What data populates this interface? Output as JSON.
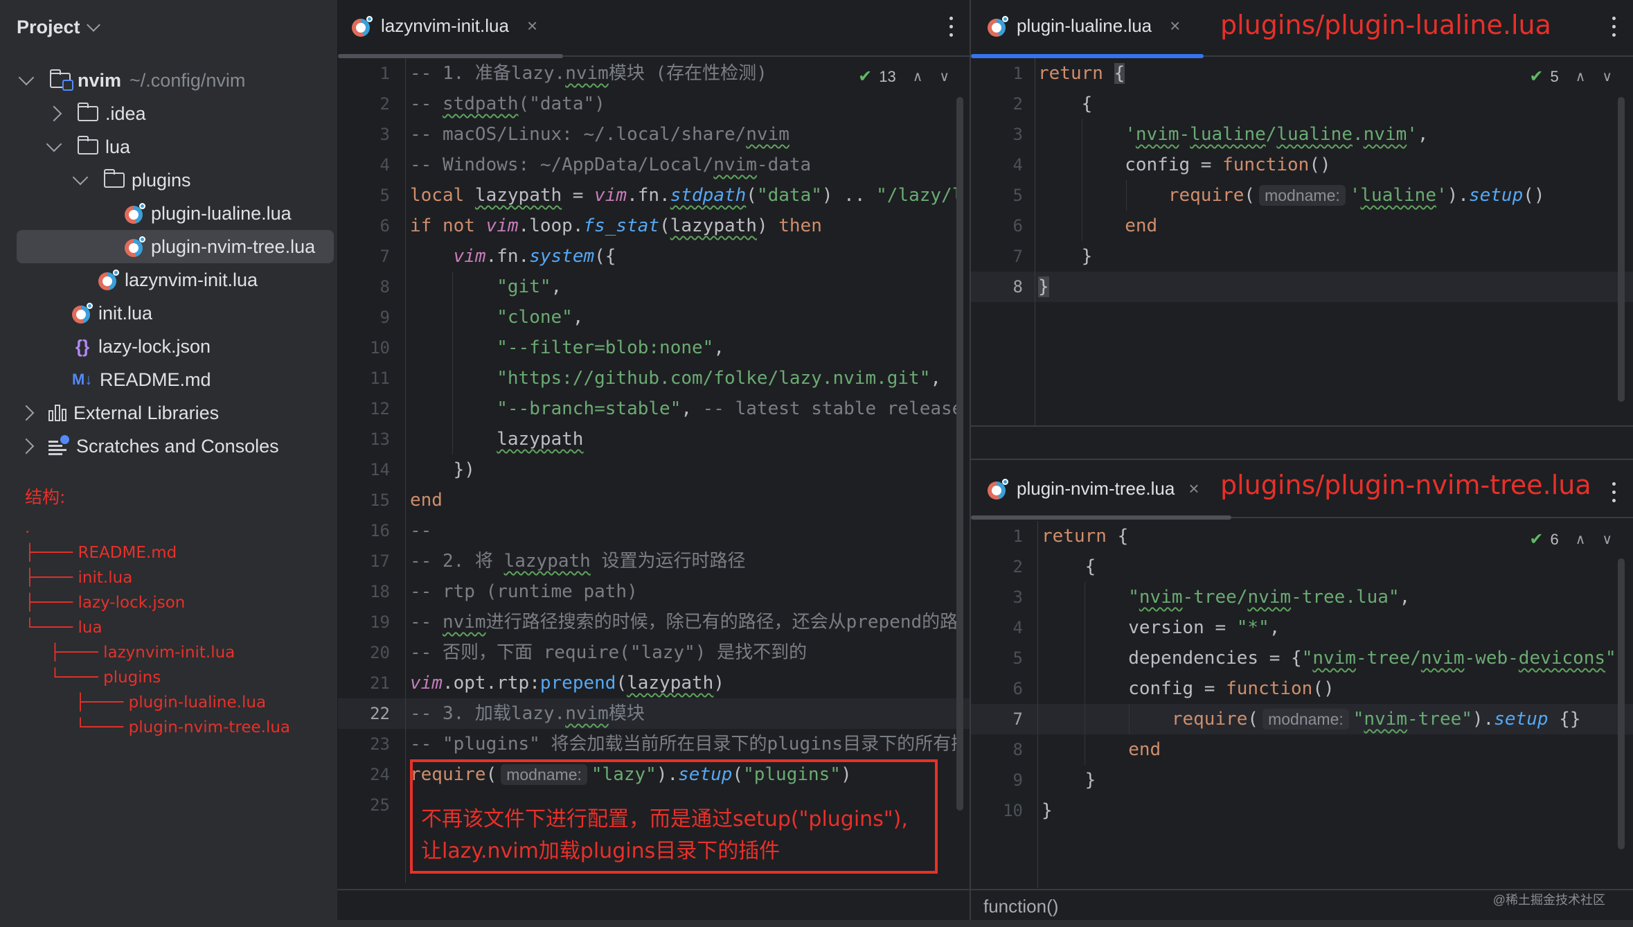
{
  "sidebar": {
    "title": "Project",
    "tree": [
      {
        "label": "nvim",
        "sub": "~/.config/nvim",
        "icon": "module-folder-icon",
        "expanded": true
      },
      {
        "label": ".idea",
        "icon": "folder-icon",
        "expanded": false
      },
      {
        "label": "lua",
        "icon": "folder-icon",
        "expanded": true
      },
      {
        "label": "plugins",
        "icon": "folder-icon",
        "expanded": true
      },
      {
        "label": "plugin-lualine.lua",
        "icon": "lua-file-icon"
      },
      {
        "label": "plugin-nvim-tree.lua",
        "icon": "lua-file-icon",
        "selected": true
      },
      {
        "label": "lazynvim-init.lua",
        "icon": "lua-file-icon"
      },
      {
        "label": "init.lua",
        "icon": "lua-file-icon"
      },
      {
        "label": "lazy-lock.json",
        "icon": "json-file-icon",
        "glyph": "{}"
      },
      {
        "label": "README.md",
        "icon": "markdown-file-icon",
        "glyph": "M↓"
      },
      {
        "label": "External Libraries",
        "icon": "libraries-icon",
        "expanded": false
      },
      {
        "label": "Scratches and Consoles",
        "icon": "scratches-icon",
        "expanded": false
      }
    ]
  },
  "annotation": {
    "structure_title": "结构:",
    "structure_lines": [
      ".",
      "├──── README.md",
      "├──── init.lua",
      "├──── lazy-lock.json",
      "└──── lua",
      "     ├──── lazynvim-init.lua",
      "     └──── plugins",
      "          ├──── plugin-lualine.lua",
      "          └──── plugin-nvim-tree.lua"
    ],
    "middle_note_line1": "不再该文件下进行配置，而是通过setup(\"plugins\"),",
    "middle_note_line2": "让lazy.nvim加载plugins目录下的插件",
    "top_right_path": "plugins/plugin-lualine.lua",
    "bottom_right_path": "plugins/plugin-nvim-tree.lua",
    "color": "#e8302a"
  },
  "editors": {
    "main": {
      "tab": "lazynvim-init.lua",
      "inspections": "13",
      "current_line": 22,
      "lines": [
        "1",
        "2",
        "3",
        "4",
        "5",
        "6",
        "7",
        "8",
        "9",
        "10",
        "11",
        "12",
        "13",
        "14",
        "15",
        "16",
        "17",
        "18",
        "19",
        "20",
        "21",
        "22",
        "23",
        "24",
        "25"
      ]
    },
    "top_right": {
      "tab": "plugin-lualine.lua",
      "inspections": "5",
      "current_line": 8,
      "lines": [
        "1",
        "2",
        "3",
        "4",
        "5",
        "6",
        "7",
        "8"
      ]
    },
    "bottom_right": {
      "tab": "plugin-nvim-tree.lua",
      "inspections": "6",
      "current_line": 7,
      "lines": [
        "1",
        "2",
        "3",
        "4",
        "5",
        "6",
        "7",
        "8",
        "9",
        "10"
      ],
      "breadcrumb": "function()"
    }
  },
  "code": {
    "main": [
      [
        {
          "t": "-- 1. 准备lazy.",
          "c": "c"
        },
        {
          "t": "nvim",
          "c": "c w"
        },
        {
          "t": "模块 (存在性检测)",
          "c": "c"
        }
      ],
      [
        {
          "t": "-- ",
          "c": "c"
        },
        {
          "t": "stdpath",
          "c": "c w"
        },
        {
          "t": "(\"data\")",
          "c": "c"
        }
      ],
      [
        {
          "t": "-- macOS/Linux: ~/.local/share/",
          "c": "c"
        },
        {
          "t": "nvim",
          "c": "c w"
        }
      ],
      [
        {
          "t": "-- Windows: ~/AppData/Local/",
          "c": "c"
        },
        {
          "t": "nvim",
          "c": "c w"
        },
        {
          "t": "-data",
          "c": "c"
        }
      ],
      [
        {
          "t": "local ",
          "c": "k"
        },
        {
          "t": "lazypath",
          "c": "w"
        },
        {
          "t": " = "
        },
        {
          "t": "vim",
          "c": "g"
        },
        {
          "t": ".fn."
        },
        {
          "t": "stdpath",
          "c": "f w"
        },
        {
          "t": "("
        },
        {
          "t": "\"data\"",
          "c": "s"
        },
        {
          "t": ") .. "
        },
        {
          "t": "\"/lazy/lazy.nvim\"",
          "c": "s"
        }
      ],
      [
        {
          "t": "if not ",
          "c": "k"
        },
        {
          "t": "vim",
          "c": "g"
        },
        {
          "t": ".loop."
        },
        {
          "t": "fs_stat",
          "c": "f"
        },
        {
          "t": "("
        },
        {
          "t": "lazypath",
          "c": "w"
        },
        {
          "t": ") "
        },
        {
          "t": "then",
          "c": "k"
        }
      ],
      [
        {
          "t": "    "
        },
        {
          "t": "vim",
          "c": "g"
        },
        {
          "t": ".fn."
        },
        {
          "t": "system",
          "c": "f"
        },
        {
          "t": "({"
        }
      ],
      [
        {
          "t": "        "
        },
        {
          "t": "\"git\"",
          "c": "s"
        },
        {
          "t": ","
        }
      ],
      [
        {
          "t": "        "
        },
        {
          "t": "\"clone\"",
          "c": "s"
        },
        {
          "t": ","
        }
      ],
      [
        {
          "t": "        "
        },
        {
          "t": "\"--filter=blob:none\"",
          "c": "s"
        },
        {
          "t": ","
        }
      ],
      [
        {
          "t": "        "
        },
        {
          "t": "\"https://github.com/folke/lazy.nvim.git\"",
          "c": "s"
        },
        {
          "t": ","
        }
      ],
      [
        {
          "t": "        "
        },
        {
          "t": "\"--branch=stable\"",
          "c": "s"
        },
        {
          "t": ", "
        },
        {
          "t": "-- latest stable release",
          "c": "c"
        }
      ],
      [
        {
          "t": "        "
        },
        {
          "t": "lazypath",
          "c": "w"
        }
      ],
      [
        {
          "t": "    })"
        }
      ],
      [
        {
          "t": "end",
          "c": "k"
        }
      ],
      [
        {
          "t": "--",
          "c": "c"
        }
      ],
      [
        {
          "t": "-- 2. 将 ",
          "c": "c"
        },
        {
          "t": "lazypath",
          "c": "c w"
        },
        {
          "t": " 设置为运行时路径",
          "c": "c"
        }
      ],
      [
        {
          "t": "-- rtp (runtime path)",
          "c": "c"
        }
      ],
      [
        {
          "t": "-- ",
          "c": "c"
        },
        {
          "t": "nvim",
          "c": "c w"
        },
        {
          "t": "进行路径搜索的时候，除已有的路径，还会从prepend的路径中查找",
          "c": "c"
        }
      ],
      [
        {
          "t": "-- 否则，下面 require(\"lazy\") 是找不到的",
          "c": "c"
        }
      ],
      [
        {
          "t": "vim",
          "c": "g"
        },
        {
          "t": ".opt.rtp:"
        },
        {
          "t": "prepend",
          "c": "fn"
        },
        {
          "t": "("
        },
        {
          "t": "lazypath",
          "c": "w"
        },
        {
          "t": ")"
        }
      ],
      [
        {
          "t": "-- 3. 加载lazy.",
          "c": "c"
        },
        {
          "t": "nvim",
          "c": "c w"
        },
        {
          "t": "模块",
          "c": "c"
        }
      ],
      [
        {
          "t": "-- \"plugins\" 将会加载当前所在目录下的plugins目录下的所有插件",
          "c": "c"
        }
      ],
      [
        {
          "t": "require",
          "c": "k"
        },
        {
          "t": "("
        },
        {
          "t": "modname:",
          "c": "hint"
        },
        {
          "t": "\"lazy\"",
          "c": "s"
        },
        {
          "t": ")."
        },
        {
          "t": "setup",
          "c": "f"
        },
        {
          "t": "("
        },
        {
          "t": "\"plugins\"",
          "c": "s"
        },
        {
          "t": ")"
        }
      ],
      []
    ],
    "top_right": [
      [
        {
          "t": "return ",
          "c": "k"
        },
        {
          "t": "{",
          "c": "brace-hl"
        }
      ],
      [
        {
          "t": "    {"
        }
      ],
      [
        {
          "t": "        "
        },
        {
          "t": "'",
          "c": "s"
        },
        {
          "t": "nvim",
          "c": "s w"
        },
        {
          "t": "-",
          "c": "s"
        },
        {
          "t": "lualine",
          "c": "s w"
        },
        {
          "t": "/",
          "c": "s"
        },
        {
          "t": "lualine",
          "c": "s w"
        },
        {
          "t": ".",
          "c": "s"
        },
        {
          "t": "nvim",
          "c": "s w"
        },
        {
          "t": "'",
          "c": "s"
        },
        {
          "t": ","
        }
      ],
      [
        {
          "t": "        config = "
        },
        {
          "t": "function",
          "c": "k"
        },
        {
          "t": "()"
        }
      ],
      [
        {
          "t": "            "
        },
        {
          "t": "require",
          "c": "k"
        },
        {
          "t": "("
        },
        {
          "t": "modname:",
          "c": "hint"
        },
        {
          "t": "'",
          "c": "s"
        },
        {
          "t": "lualine",
          "c": "s w"
        },
        {
          "t": "'",
          "c": "s"
        },
        {
          "t": ")."
        },
        {
          "t": "setup",
          "c": "f"
        },
        {
          "t": "()"
        }
      ],
      [
        {
          "t": "        "
        },
        {
          "t": "end",
          "c": "k"
        }
      ],
      [
        {
          "t": "    }"
        }
      ],
      [
        {
          "t": "}",
          "c": "brace-hl"
        }
      ]
    ],
    "bottom_right": [
      [
        {
          "t": "return ",
          "c": "k"
        },
        {
          "t": "{"
        }
      ],
      [
        {
          "t": "    {"
        }
      ],
      [
        {
          "t": "        "
        },
        {
          "t": "\"",
          "c": "s"
        },
        {
          "t": "nvim",
          "c": "s w"
        },
        {
          "t": "-tree/",
          "c": "s"
        },
        {
          "t": "nvim",
          "c": "s w"
        },
        {
          "t": "-tree.lua\"",
          "c": "s"
        },
        {
          "t": ","
        }
      ],
      [
        {
          "t": "        version = "
        },
        {
          "t": "\"*\"",
          "c": "s"
        },
        {
          "t": ","
        }
      ],
      [
        {
          "t": "        dependencies = {"
        },
        {
          "t": "\"",
          "c": "s"
        },
        {
          "t": "nvim",
          "c": "s w"
        },
        {
          "t": "-tree/",
          "c": "s"
        },
        {
          "t": "nvim",
          "c": "s w"
        },
        {
          "t": "-web-",
          "c": "s"
        },
        {
          "t": "devicons",
          "c": "s w"
        },
        {
          "t": "\"",
          "c": "s"
        },
        {
          "t": "},"
        }
      ],
      [
        {
          "t": "        config = "
        },
        {
          "t": "function",
          "c": "k"
        },
        {
          "t": "()"
        }
      ],
      [
        {
          "t": "            "
        },
        {
          "t": "require",
          "c": "k"
        },
        {
          "t": "("
        },
        {
          "t": "modname:",
          "c": "hint"
        },
        {
          "t": "\"",
          "c": "s"
        },
        {
          "t": "nvim",
          "c": "s w"
        },
        {
          "t": "-tree\"",
          "c": "s"
        },
        {
          "t": ")."
        },
        {
          "t": "setup",
          "c": "f"
        },
        {
          "t": " {}"
        }
      ],
      [
        {
          "t": "        "
        },
        {
          "t": "end",
          "c": "k"
        }
      ],
      [
        {
          "t": "    }"
        }
      ],
      [
        {
          "t": "}"
        }
      ]
    ]
  },
  "watermark": "@稀土掘金技术社区"
}
